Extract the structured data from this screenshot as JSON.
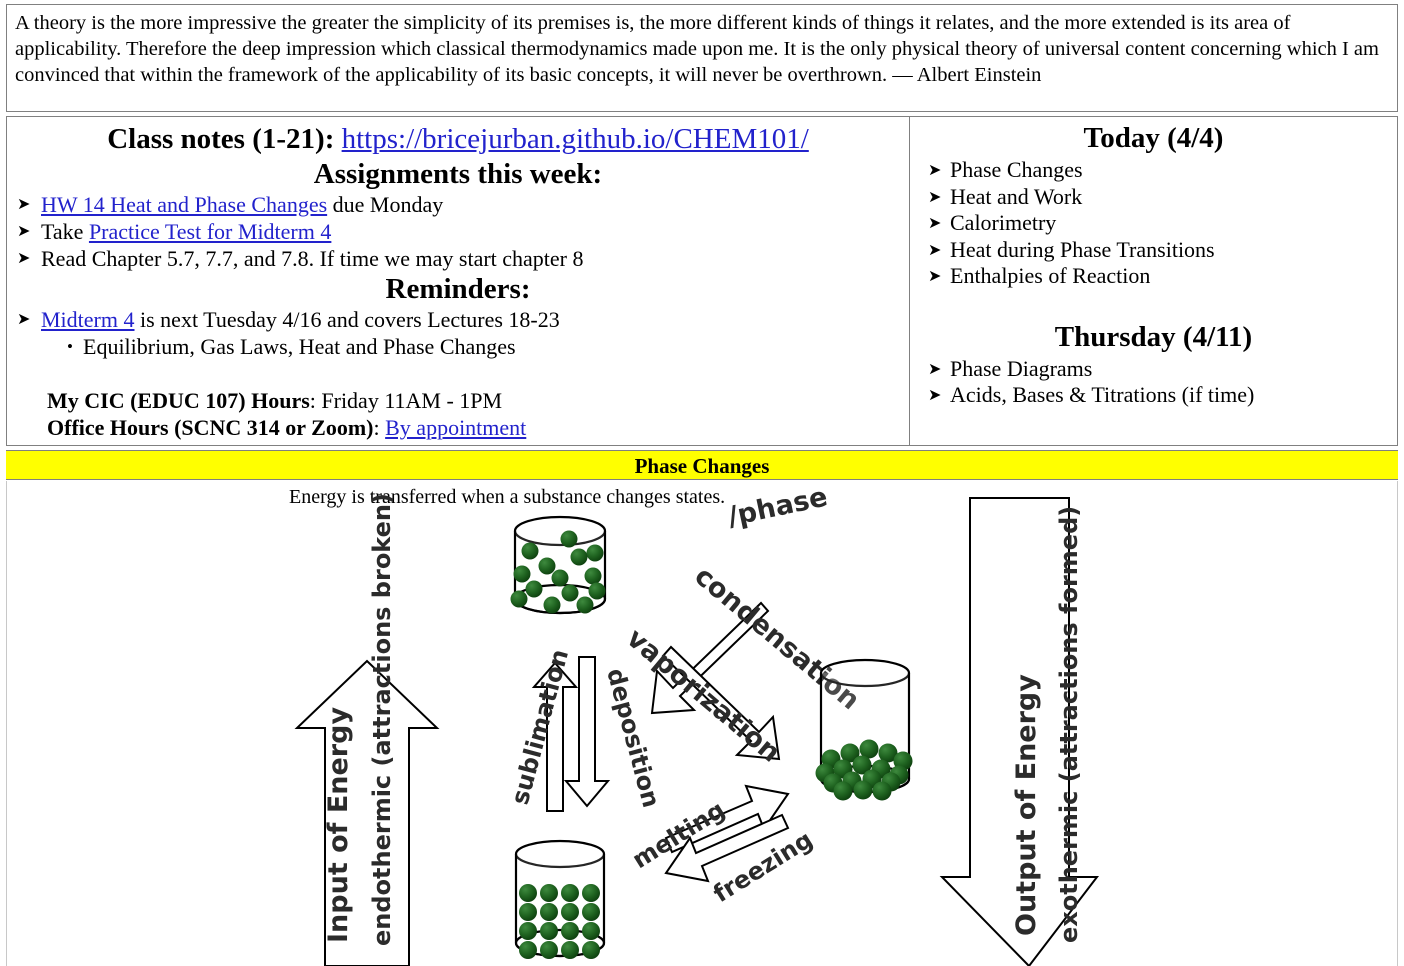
{
  "quote": {
    "text": "A theory is the more impressive the greater the simplicity of its premises is, the more different kinds of things it relates, and the more extended is its area of applicability. Therefore the deep impression which classical thermodynamics made upon me. It is the only physical theory of universal content concerning which I am convinced that within the framework of the applicability of its basic concepts, it will never be overthrown. — Albert Einstein"
  },
  "left_panel": {
    "class_notes_label": "Class notes (1-21):",
    "class_notes_url": "https://bricejurban.github.io/CHEM101/",
    "assignments_heading": "Assignments this week:",
    "assignments": [
      {
        "link": "HW 14 Heat and Phase Changes",
        "after": " due Monday",
        "before": ""
      },
      {
        "before": "Take ",
        "link": "Practice Test for Midterm 4",
        "after": ""
      },
      {
        "before": "Read Chapter 5.7, 7.7, and 7.8. If time we may start chapter 8",
        "link": "",
        "after": ""
      }
    ],
    "reminders_heading": "Reminders:",
    "reminders": [
      {
        "before": "",
        "link": "Midterm 4",
        "after": " is next Tuesday 4/16 and covers Lectures 18-23"
      }
    ],
    "reminder_sub": "Equilibrium, Gas Laws, Heat and Phase Changes",
    "cic_label": "My CIC (EDUC 107) Hours",
    "cic_value": ": Friday 11AM - 1PM",
    "office_label": "Office Hours (SCNC 314 or Zoom)",
    "office_sep": ": ",
    "office_link": "By appointment"
  },
  "right_panel": {
    "today_heading": "Today (4/4)",
    "today_items": [
      "Phase Changes",
      "Heat and Work",
      "Calorimetry",
      "Heat during Phase Transitions",
      "Enthalpies of Reaction"
    ],
    "thursday_heading": "Thursday (4/11)",
    "thursday_items": [
      "Phase Diagrams",
      "Acids, Bases & Titrations (if time)"
    ]
  },
  "banner": {
    "title": "Phase Changes"
  },
  "diagram": {
    "caption": "Energy is transferred when a substance changes states.",
    "caption_annotation": "/phase",
    "left_arrow_line1": "Input of Energy",
    "left_arrow_line2": "endothermic (attractions broken)",
    "right_arrow_line1": "Output of Energy",
    "right_arrow_line2": "exothermic (attractions formed)",
    "sublimation": "sublimation",
    "deposition": "deposition",
    "vaporization": "vaporization",
    "condensation": "condensation",
    "melting": "melting",
    "freezing": "freezing"
  },
  "colors": {
    "banner_bg": "#ffff00",
    "link": "#2222cc",
    "particle": "#1d5c1d",
    "border": "#808080"
  }
}
